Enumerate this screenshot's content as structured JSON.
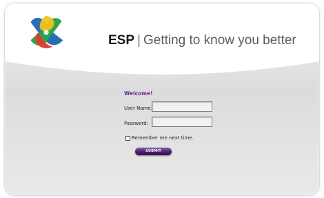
{
  "header": {
    "brand_name": "ESP",
    "separator": "|",
    "tagline": "Getting to know you better",
    "logo": "esp-logo"
  },
  "login": {
    "welcome": "Welcome!",
    "username_label": "User Name:",
    "username_value": "",
    "password_label": "Password:",
    "password_value": "",
    "remember_label": "Remember me next time.",
    "remember_checked": false,
    "submit_label": "SUBMIT"
  },
  "colors": {
    "accent_purple": "#5a2a7e",
    "logo_green": "#2fa34a",
    "logo_yellow": "#f2c21a",
    "logo_red": "#e23a2b",
    "logo_blue": "#2a6fb6"
  }
}
